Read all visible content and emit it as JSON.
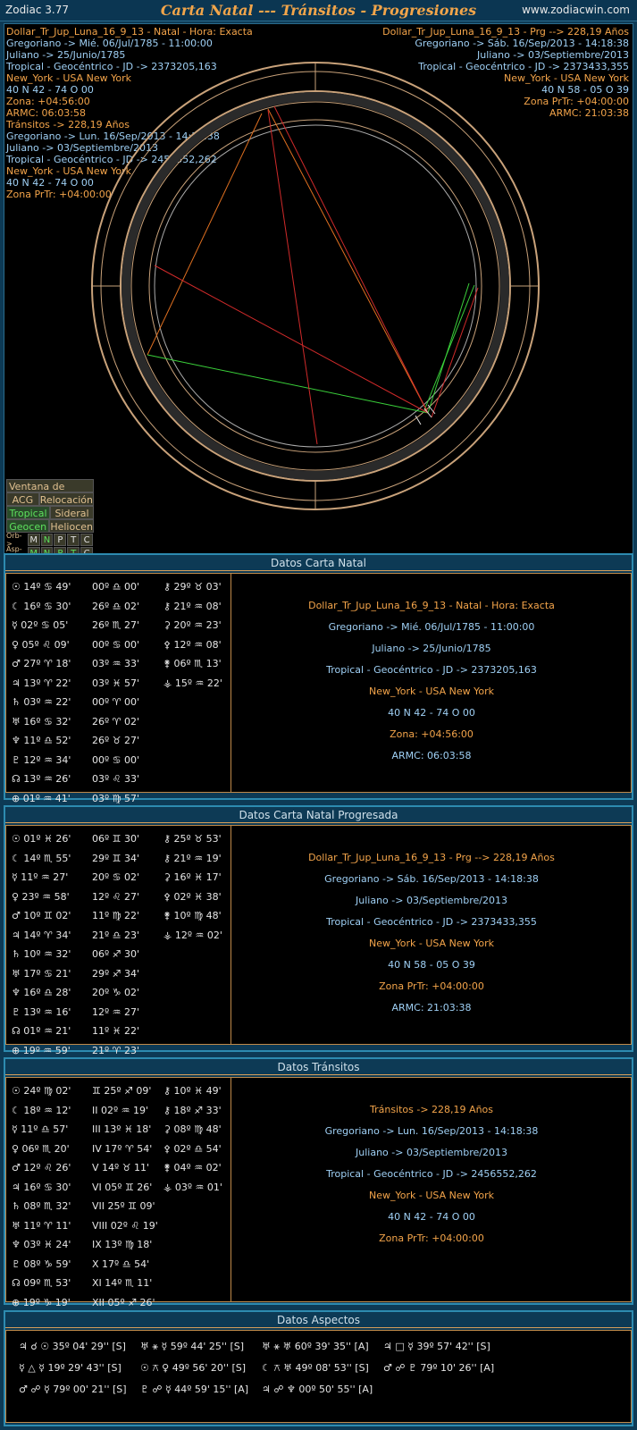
{
  "topbar": {
    "app": "Zodiac 3.77",
    "title": "Carta Natal --- Tránsitos - Progresiones",
    "site": "www.zodiacwin.com"
  },
  "chart_info_left": [
    {
      "t": "Dollar_Tr_Jup_Luna_16_9_13 - Natal - Hora: Exacta",
      "c": "or"
    },
    {
      "t": "Gregoriano -> Mié. 06/Jul/1785 - 11:00:00",
      "c": "bl"
    },
    {
      "t": "Juliano -> 25/Junio/1785",
      "c": "bl"
    },
    {
      "t": "Tropical - Geocéntrico - JD -> 2373205,163",
      "c": "bl"
    },
    {
      "t": "New_York - USA New York",
      "c": "or"
    },
    {
      "t": "40 N 42 - 74 O 00",
      "c": "bl"
    },
    {
      "t": "Zona: +04:56:00",
      "c": "or"
    },
    {
      "t": "ARMC: 06:03:58",
      "c": "or"
    },
    {
      "t": "Tránsitos -> 228,19 Años",
      "c": "or"
    },
    {
      "t": "Gregoriano -> Lun. 16/Sep/2013 - 14:18:38",
      "c": "bl"
    },
    {
      "t": "Juliano -> 03/Septiembre/2013",
      "c": "bl"
    },
    {
      "t": "Tropical - Geocéntrico - JD -> 2456552,262",
      "c": "bl"
    },
    {
      "t": "New_York - USA New York",
      "c": "or"
    },
    {
      "t": "40 N 42 - 74 O 00",
      "c": "bl"
    },
    {
      "t": "Zona PrTr: +04:00:00",
      "c": "or"
    }
  ],
  "chart_info_right": [
    {
      "t": "Dollar_Tr_Jup_Luna_16_9_13 - Prg --> 228,19 Años",
      "c": "or"
    },
    {
      "t": "Gregoriano -> Sáb. 16/Sep/2013 - 14:18:38",
      "c": "bl"
    },
    {
      "t": "Juliano -> 03/Septiembre/2013",
      "c": "bl"
    },
    {
      "t": "Tropical - Geocéntrico - JD -> 2373433,355",
      "c": "bl"
    },
    {
      "t": "New_York - USA New York",
      "c": "or"
    },
    {
      "t": "40 N 58 - 05 O 39",
      "c": "bl"
    },
    {
      "t": "Zona PrTr: +04:00:00",
      "c": "or"
    },
    {
      "t": "ARMC: 21:03:38",
      "c": "or"
    }
  ],
  "menu": {
    "ventana": "Ventana de Ciclos",
    "acg": "ACG",
    "reloc": "Relocación",
    "tropical": "Tropical",
    "sideral": "Sideral",
    "geocen": "Geocen",
    "helio": "Heliocen",
    "orb": "Orb->",
    "asp": "Asp->",
    "btns": [
      "M",
      "N",
      "P",
      "T",
      "C"
    ]
  },
  "natal": {
    "header": "Datos Carta Natal",
    "rows": [
      [
        "☉ 14º ♋ 49'",
        "00º ♎ 00'",
        "⚷ 29º ♉ 03'"
      ],
      [
        "☾ 16º ♋ 30'",
        "26º ♎ 02'",
        "⚷ 21º ♒ 08'"
      ],
      [
        "☿ 02º ♋ 05'",
        "26º ♏ 27'",
        "⚳ 20º ♒ 23'"
      ],
      [
        "♀ 05º ♌ 09'",
        "00º ♋ 00'",
        "⚴ 12º ♒ 08'"
      ],
      [
        "♂ 27º ♈ 18'",
        "03º ♒ 33'",
        "⚵ 06º ♏ 13'"
      ],
      [
        "♃ 13º ♈ 22'",
        "03º ♓ 57'",
        "⚶ 15º ♒ 22'"
      ],
      [
        "♄ 03º ♒ 22'",
        "00º ♈ 00'",
        ""
      ],
      [
        "♅ 16º ♋ 32'",
        "26º ♈ 02'",
        ""
      ],
      [
        "♆ 11º ♎ 52'",
        "26º ♉ 27'",
        ""
      ],
      [
        "♇ 12º ♒ 34'",
        "00º ♋ 00'",
        ""
      ],
      [
        "☊ 13º ♒ 26'",
        "03º ♌ 33'",
        ""
      ],
      [
        "⊕ 01º ♒ 41'",
        "03º ♍ 57'",
        ""
      ]
    ],
    "info": [
      {
        "t": "Dollar_Tr_Jup_Luna_16_9_13 - Natal - Hora: Exacta",
        "c": "or"
      },
      {
        "t": "Gregoriano -> Mié. 06/Jul/1785 - 11:00:00",
        "c": "bl"
      },
      {
        "t": "Juliano -> 25/Junio/1785",
        "c": "bl"
      },
      {
        "t": "Tropical - Geocéntrico - JD -> 2373205,163",
        "c": "bl"
      },
      {
        "t": "New_York - USA New York",
        "c": "or"
      },
      {
        "t": "40 N 42 - 74 O 00",
        "c": "bl"
      },
      {
        "t": "Zona: +04:56:00",
        "c": "or"
      },
      {
        "t": "ARMC: 06:03:58",
        "c": "bl"
      }
    ]
  },
  "prog": {
    "header": "Datos Carta Natal Progresada",
    "rows": [
      [
        "☉ 01º ♓ 26'",
        "06º ♊ 30'",
        "⚷ 25º ♉ 53'"
      ],
      [
        "☾ 14º ♏ 55'",
        "29º ♊ 34'",
        "⚷ 21º ♒ 19'"
      ],
      [
        "☿ 11º ♒ 27'",
        "20º ♋ 02'",
        "⚳ 16º ♓ 17'"
      ],
      [
        "♀ 23º ♒ 58'",
        "12º ♌ 27'",
        "⚴ 02º ♓ 38'"
      ],
      [
        "♂ 10º ♊ 02'",
        "11º ♍ 22'",
        "⚵ 10º ♍ 48'"
      ],
      [
        "♃ 14º ♈ 34'",
        "21º ♎ 23'",
        "⚶ 12º ♒ 02'"
      ],
      [
        "♄ 10º ♒ 32'",
        "06º ♐ 30'",
        ""
      ],
      [
        "♅ 17º ♋ 21'",
        "29º ♐ 34'",
        ""
      ],
      [
        "♆ 16º ♎ 28'",
        "20º ♑ 02'",
        ""
      ],
      [
        "♇ 13º ♒ 16'",
        "12º ♒ 27'",
        ""
      ],
      [
        "☊ 01º ♒ 21'",
        "11º ♓ 22'",
        ""
      ],
      [
        "⊕ 19º ♒ 59'",
        "21º ♈ 23'",
        ""
      ]
    ],
    "info": [
      {
        "t": "Dollar_Tr_Jup_Luna_16_9_13 - Prg --> 228,19 Años",
        "c": "or"
      },
      {
        "t": "Gregoriano -> Sáb. 16/Sep/2013 - 14:18:38",
        "c": "bl"
      },
      {
        "t": "Juliano -> 03/Septiembre/2013",
        "c": "bl"
      },
      {
        "t": "Tropical - Geocéntrico - JD -> 2373433,355",
        "c": "bl"
      },
      {
        "t": "New_York - USA New York",
        "c": "or"
      },
      {
        "t": "40 N 58 - 05 O 39",
        "c": "bl"
      },
      {
        "t": "Zona PrTr: +04:00:00",
        "c": "or"
      },
      {
        "t": "ARMC: 21:03:38",
        "c": "bl"
      }
    ]
  },
  "trans": {
    "header": "Datos Tránsitos",
    "rows": [
      [
        "☉ 24º ♍ 02'",
        "♊ 25º ♐ 09'",
        "⚷ 10º ♓ 49'"
      ],
      [
        "☾ 18º ♒ 12'",
        "II 02º ♒ 19'",
        "⚷ 18º ♐ 33'"
      ],
      [
        "☿ 11º ♎ 57'",
        "III 13º ♓ 18'",
        "⚳ 08º ♍ 48'"
      ],
      [
        "♀ 06º ♏ 20'",
        "IV 17º ♈ 54'",
        "⚴ 02º ♎ 54'"
      ],
      [
        "♂ 12º ♌ 26'",
        "V 14º ♉ 11'",
        "⚵ 04º ♒ 02'"
      ],
      [
        "♃ 16º ♋ 30'",
        "VI 05º ♊ 26'",
        "⚶ 03º ♒ 01'"
      ],
      [
        "♄ 08º ♏ 32'",
        "VII 25º ♊ 09'",
        ""
      ],
      [
        "♅ 11º ♈ 11'",
        "VIII 02º ♌ 19'",
        ""
      ],
      [
        "♆ 03º ♓ 24'",
        "IX 13º ♍ 18'",
        ""
      ],
      [
        "♇ 08º ♑ 59'",
        "X 17º ♎ 54'",
        ""
      ],
      [
        "☊ 09º ♏ 53'",
        "XI 14º ♏ 11'",
        ""
      ],
      [
        "⊕ 19º ♑ 19'",
        "XII 05º ♐ 26'",
        ""
      ]
    ],
    "info": [
      {
        "t": "Tránsitos -> 228,19 Años",
        "c": "or"
      },
      {
        "t": "Gregoriano -> Lun. 16/Sep/2013 - 14:18:38",
        "c": "bl"
      },
      {
        "t": "Juliano -> 03/Septiembre/2013",
        "c": "bl"
      },
      {
        "t": "Tropical - Geocéntrico - JD -> 2456552,262",
        "c": "bl"
      },
      {
        "t": "New_York - USA New York",
        "c": "or"
      },
      {
        "t": "40 N 42 - 74 O 00",
        "c": "bl"
      },
      {
        "t": "Zona PrTr: +04:00:00",
        "c": "or"
      }
    ]
  },
  "aspects": {
    "header": "Datos Aspectos",
    "rows": [
      [
        "♃ ☌ ☉ 35º 04' 29'' [S]",
        "♅ ⚹ ☿ 59º 44' 25'' [S]",
        "♅ ⚹ ♅ 60º 39' 35'' [A]",
        "♃ □ ☿ 39º 57' 42'' [S]"
      ],
      [
        "☿ △ ☿ 19º 29' 43'' [S]",
        "☉ ⚻ ♀ 49º 56' 20'' [S]",
        "☾ ⚻ ♅ 49º 08' 53'' [S]",
        "♂ ☍ ♇ 79º 10' 26'' [A]"
      ],
      [
        "♂ ☍ ☿ 79º 00' 21'' [S]",
        "♇ ☍ ☿ 44º 59' 15'' [A]",
        "♃ ☍ ♆ 00º 50' 55'' [A]",
        ""
      ]
    ]
  }
}
